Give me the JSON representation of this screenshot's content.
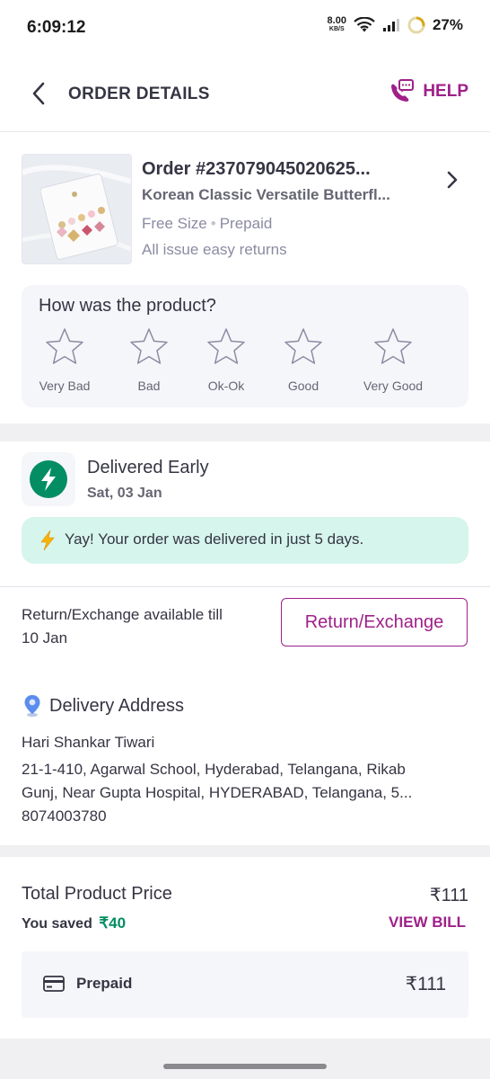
{
  "status_bar": {
    "time": "6:09:12",
    "net_speed_value": "8.00",
    "net_speed_unit": "KB/S",
    "battery": "27%"
  },
  "header": {
    "title": "ORDER DETAILS",
    "help_label": "HELP"
  },
  "order": {
    "order_id": "Order #237079045020625...",
    "product_name": "Korean Classic Versatile  Butterfl...",
    "size": "Free Size",
    "payment_mode": "Prepaid",
    "returns_note": "All issue easy returns"
  },
  "rating": {
    "question": "How was the product?",
    "options": [
      "Very Bad",
      "Bad",
      "Ok-Ok",
      "Good",
      "Very Good"
    ],
    "selected": 0
  },
  "delivery": {
    "status": "Delivered Early",
    "date": "Sat, 03 Jan",
    "banner_icon": "⚡",
    "banner": "Yay! Your order was delivered in just 5 days."
  },
  "return_exchange": {
    "note_line1": "Return/Exchange available till",
    "note_line2": "10 Jan",
    "button_label": "Return/Exchange"
  },
  "address": {
    "heading": "Delivery Address",
    "name": "Hari Shankar Tiwari",
    "line1": "21-1-410, Agarwal School, Hyderabad, Telangana, Rikab",
    "line2": "Gunj,  Near Gupta Hospital, HYDERABAD, Telangana, 5...",
    "phone": "8074003780"
  },
  "price": {
    "total_label": "Total Product Price",
    "total_value": "₹111",
    "saved_label": "You saved",
    "saved_value": "₹40",
    "view_bill_label": "VIEW BILL",
    "payment_label": "Prepaid",
    "payment_value": "₹111"
  },
  "colors": {
    "brand": "#9f2089",
    "success": "#038d63",
    "success_bg": "#d6f5ec",
    "text_primary": "#353543",
    "text_secondary": "#8b8ba3"
  },
  "icons": {
    "back": "chevron-left-icon",
    "help": "phone-chat-icon",
    "chevron": "chevron-right-icon",
    "star": "star-outline-icon",
    "bolt": "lightning-icon",
    "pin": "location-pin-icon",
    "card": "credit-card-icon"
  }
}
